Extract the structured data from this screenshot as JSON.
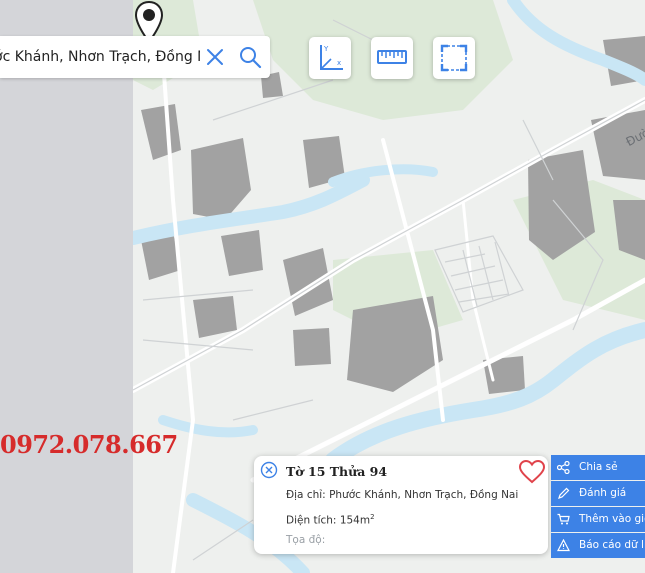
{
  "search": {
    "value": "ớc Khánh, Nhơn Trạch, Đồng Nai"
  },
  "toolbar": {
    "tools": [
      {
        "icon": "coordinate-axes-icon",
        "axis_y": "Y",
        "axis_x": "x"
      },
      {
        "icon": "ruler-icon"
      },
      {
        "icon": "area-select-icon"
      }
    ]
  },
  "phone": "0972.078.667",
  "map": {
    "road_label": "Đường Phạm Thái Bường"
  },
  "info_card": {
    "title": "Tờ 15 Thửa 94",
    "address_label": "Địa chỉ:",
    "address_value": "Phước Khánh, Nhơn Trạch, Đồng Nai",
    "area_label": "Diện tích:",
    "area_value": "154m",
    "area_unit_sup": "2",
    "coord_label": "Tọa độ:"
  },
  "actions": [
    {
      "label": "Chia sẻ",
      "icon": "share-icon"
    },
    {
      "label": "Đánh giá",
      "icon": "pencil-icon"
    },
    {
      "label": "Thêm vào giỏ",
      "icon": "cart-icon"
    },
    {
      "label": "Báo cáo dữ liệu",
      "icon": "warning-icon"
    }
  ],
  "colors": {
    "accent": "#3d82e6",
    "phone": "#d62b2b",
    "heart": "#e0434b",
    "water": "#c9e6f5",
    "vegetation": "#dde9d8",
    "built_up": "#9a9a9a",
    "map_bg": "#eef0ee",
    "left_panel": "#d4d5d9"
  }
}
